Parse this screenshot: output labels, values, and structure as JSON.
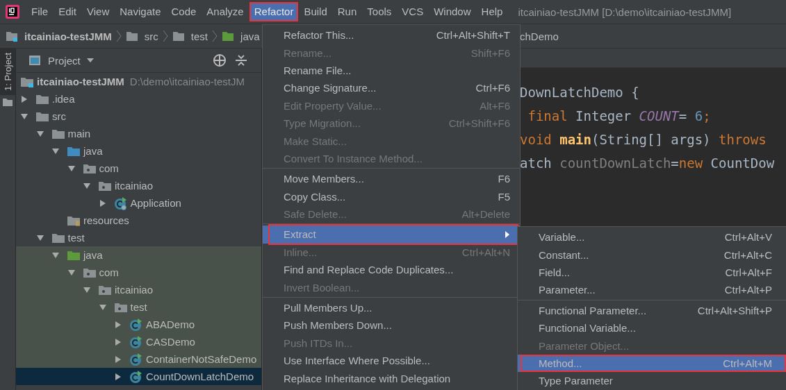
{
  "menubar": {
    "items": [
      {
        "label": "File",
        "selected": false,
        "annotated": false
      },
      {
        "label": "Edit",
        "selected": false,
        "annotated": false
      },
      {
        "label": "View",
        "selected": false,
        "annotated": false
      },
      {
        "label": "Navigate",
        "selected": false,
        "annotated": false
      },
      {
        "label": "Code",
        "selected": false,
        "annotated": false
      },
      {
        "label": "Analyze",
        "selected": false,
        "annotated": false
      },
      {
        "label": "Refactor",
        "selected": true,
        "annotated": true
      },
      {
        "label": "Build",
        "selected": false,
        "annotated": false
      },
      {
        "label": "Run",
        "selected": false,
        "annotated": false
      },
      {
        "label": "Tools",
        "selected": false,
        "annotated": false
      },
      {
        "label": "VCS",
        "selected": false,
        "annotated": false
      },
      {
        "label": "Window",
        "selected": false,
        "annotated": false
      },
      {
        "label": "Help",
        "selected": false,
        "annotated": false
      }
    ],
    "title": "itcainiao-testJMM [D:\\demo\\itcainiao-testJMM]"
  },
  "breadcrumb": [
    {
      "label": "itcainiao-testJMM",
      "kind": "module"
    },
    {
      "label": "src",
      "kind": "folder"
    },
    {
      "label": "test",
      "kind": "folder"
    },
    {
      "label": "java",
      "kind": "test-folder"
    }
  ],
  "breadcrumb_tail": "chDemo",
  "side_tab": {
    "label": "1: Project",
    "selected": true
  },
  "project": {
    "title": "Project",
    "tree": [
      {
        "label": "itcainiao-testJMM",
        "kind": "module",
        "hint": "D:\\demo\\itcainiao-testJM",
        "selected": false,
        "children": [
          {
            "label": ".idea",
            "kind": "folder",
            "expanded": false,
            "selected": false
          },
          {
            "label": "src",
            "kind": "folder",
            "expanded": true,
            "selected": false,
            "children": [
              {
                "label": "main",
                "kind": "folder",
                "expanded": true,
                "selected": false,
                "children": [
                  {
                    "label": "java",
                    "kind": "source-folder",
                    "expanded": true,
                    "selected": false,
                    "children": [
                      {
                        "label": "com",
                        "kind": "package",
                        "expanded": true,
                        "selected": false,
                        "children": [
                          {
                            "label": "itcainiao",
                            "kind": "package",
                            "expanded": true,
                            "selected": false,
                            "children": [
                              {
                                "label": "Application",
                                "kind": "app-class",
                                "expanded": false,
                                "selected": false
                              }
                            ]
                          }
                        ]
                      }
                    ]
                  },
                  {
                    "label": "resources",
                    "kind": "resources",
                    "selected": false
                  }
                ]
              },
              {
                "label": "test",
                "kind": "folder",
                "expanded": true,
                "selected": false,
                "children": [
                  {
                    "label": "java",
                    "kind": "test-folder",
                    "expanded": true,
                    "selected": false,
                    "children": [
                      {
                        "label": "com",
                        "kind": "package",
                        "expanded": true,
                        "selected": false,
                        "children": [
                          {
                            "label": "itcainiao",
                            "kind": "package",
                            "expanded": true,
                            "selected": false,
                            "children": [
                              {
                                "label": "test",
                                "kind": "package",
                                "expanded": true,
                                "selected": false,
                                "children": [
                                  {
                                    "label": "ABADemo",
                                    "kind": "class",
                                    "expanded": false,
                                    "selected": false
                                  },
                                  {
                                    "label": "CASDemo",
                                    "kind": "class",
                                    "expanded": false,
                                    "selected": false
                                  },
                                  {
                                    "label": "ContainerNotSafeDemo",
                                    "kind": "class",
                                    "expanded": false,
                                    "selected": false
                                  },
                                  {
                                    "label": "CountDownLatchDemo",
                                    "kind": "class",
                                    "expanded": false,
                                    "selected": true
                                  }
                                ]
                              }
                            ]
                          }
                        ]
                      }
                    ]
                  }
                ]
              }
            ]
          }
        ]
      }
    ]
  },
  "code": [
    {
      "tokens": [
        {
          "kind": "plain",
          "text": "DownLatchDemo {"
        }
      ]
    },
    {
      "tokens": [
        {
          "kind": "keyword",
          "text": " final"
        },
        {
          "kind": "plain",
          "text": " Integer "
        },
        {
          "kind": "constant",
          "text": "COUNT"
        },
        {
          "kind": "plain",
          "text": "= "
        },
        {
          "kind": "number",
          "text": "6"
        },
        {
          "kind": "keyword",
          "text": ";"
        }
      ]
    },
    {
      "tokens": [
        {
          "kind": "keyword",
          "text": "void "
        },
        {
          "kind": "method",
          "text": "main"
        },
        {
          "kind": "plain",
          "text": "(String[] args) "
        },
        {
          "kind": "keyword",
          "text": "throws"
        }
      ]
    },
    {
      "tokens": [
        {
          "kind": "plain",
          "text": "atch "
        },
        {
          "kind": "unused",
          "text": "countDownLatch"
        },
        {
          "kind": "plain",
          "text": "="
        },
        {
          "kind": "keyword",
          "text": "new"
        },
        {
          "kind": "plain",
          "text": " CountDow"
        }
      ]
    }
  ],
  "refactor_menu": [
    [
      {
        "label": "Refactor This...",
        "shortcut": "Ctrl+Alt+Shift+T",
        "disabled": false,
        "selected": false,
        "annotated": false
      },
      {
        "label": "Rename...",
        "shortcut": "Shift+F6",
        "disabled": true,
        "selected": false,
        "annotated": false
      },
      {
        "label": "Rename File...",
        "disabled": false,
        "selected": false,
        "annotated": false
      },
      {
        "label": "Change Signature...",
        "shortcut": "Ctrl+F6",
        "disabled": false,
        "selected": false,
        "annotated": false
      },
      {
        "label": "Edit Property Value...",
        "shortcut": "Alt+F6",
        "disabled": true,
        "selected": false,
        "annotated": false
      },
      {
        "label": "Type Migration...",
        "shortcut": "Ctrl+Shift+F6",
        "disabled": true,
        "selected": false,
        "annotated": false
      },
      {
        "label": "Make Static...",
        "disabled": true,
        "selected": false,
        "annotated": false
      },
      {
        "label": "Convert To Instance Method...",
        "disabled": true,
        "selected": false,
        "annotated": false
      }
    ],
    [
      {
        "label": "Move Members...",
        "shortcut": "F6",
        "disabled": false,
        "selected": false,
        "annotated": false
      },
      {
        "label": "Copy Class...",
        "shortcut": "F5",
        "disabled": false,
        "selected": false,
        "annotated": false
      },
      {
        "label": "Safe Delete...",
        "shortcut": "Alt+Delete",
        "disabled": true,
        "selected": false,
        "annotated": false
      }
    ],
    [
      {
        "label": "Extract",
        "submenu": true,
        "disabled": false,
        "selected": true,
        "annotated": true
      },
      {
        "label": "Inline...",
        "shortcut": "Ctrl+Alt+N",
        "disabled": true,
        "selected": false,
        "annotated": false
      },
      {
        "label": "Find and Replace Code Duplicates...",
        "disabled": false,
        "selected": false,
        "annotated": false
      },
      {
        "label": "Invert Boolean...",
        "disabled": true,
        "selected": false,
        "annotated": false
      }
    ],
    [
      {
        "label": "Pull Members Up...",
        "disabled": false,
        "selected": false,
        "annotated": false
      },
      {
        "label": "Push Members Down...",
        "disabled": false,
        "selected": false,
        "annotated": false
      },
      {
        "label": "Push ITDs In...",
        "disabled": true,
        "selected": false,
        "annotated": false
      },
      {
        "label": "Use Interface Where Possible...",
        "disabled": false,
        "selected": false,
        "annotated": false
      },
      {
        "label": "Replace Inheritance with Delegation",
        "disabled": false,
        "selected": false,
        "annotated": false
      }
    ]
  ],
  "extract_menu": [
    [
      {
        "label": "Variable...",
        "shortcut": "Ctrl+Alt+V",
        "disabled": false,
        "selected": false,
        "annotated": false
      },
      {
        "label": "Constant...",
        "shortcut": "Ctrl+Alt+C",
        "disabled": false,
        "selected": false,
        "annotated": false
      },
      {
        "label": "Field...",
        "shortcut": "Ctrl+Alt+F",
        "disabled": false,
        "selected": false,
        "annotated": false
      },
      {
        "label": "Parameter...",
        "shortcut": "Ctrl+Alt+P",
        "disabled": false,
        "selected": false,
        "annotated": false
      }
    ],
    [
      {
        "label": "Functional Parameter...",
        "shortcut": "Ctrl+Alt+Shift+P",
        "disabled": false,
        "selected": false,
        "annotated": false
      },
      {
        "label": "Functional Variable...",
        "disabled": false,
        "selected": false,
        "annotated": false
      },
      {
        "label": "Parameter Object...",
        "disabled": true,
        "selected": false,
        "annotated": false
      },
      {
        "label": "Method...",
        "shortcut": "Ctrl+Alt+M",
        "disabled": false,
        "selected": true,
        "annotated": true
      },
      {
        "label": "Type Parameter",
        "disabled": false,
        "selected": false,
        "annotated": false
      }
    ]
  ]
}
